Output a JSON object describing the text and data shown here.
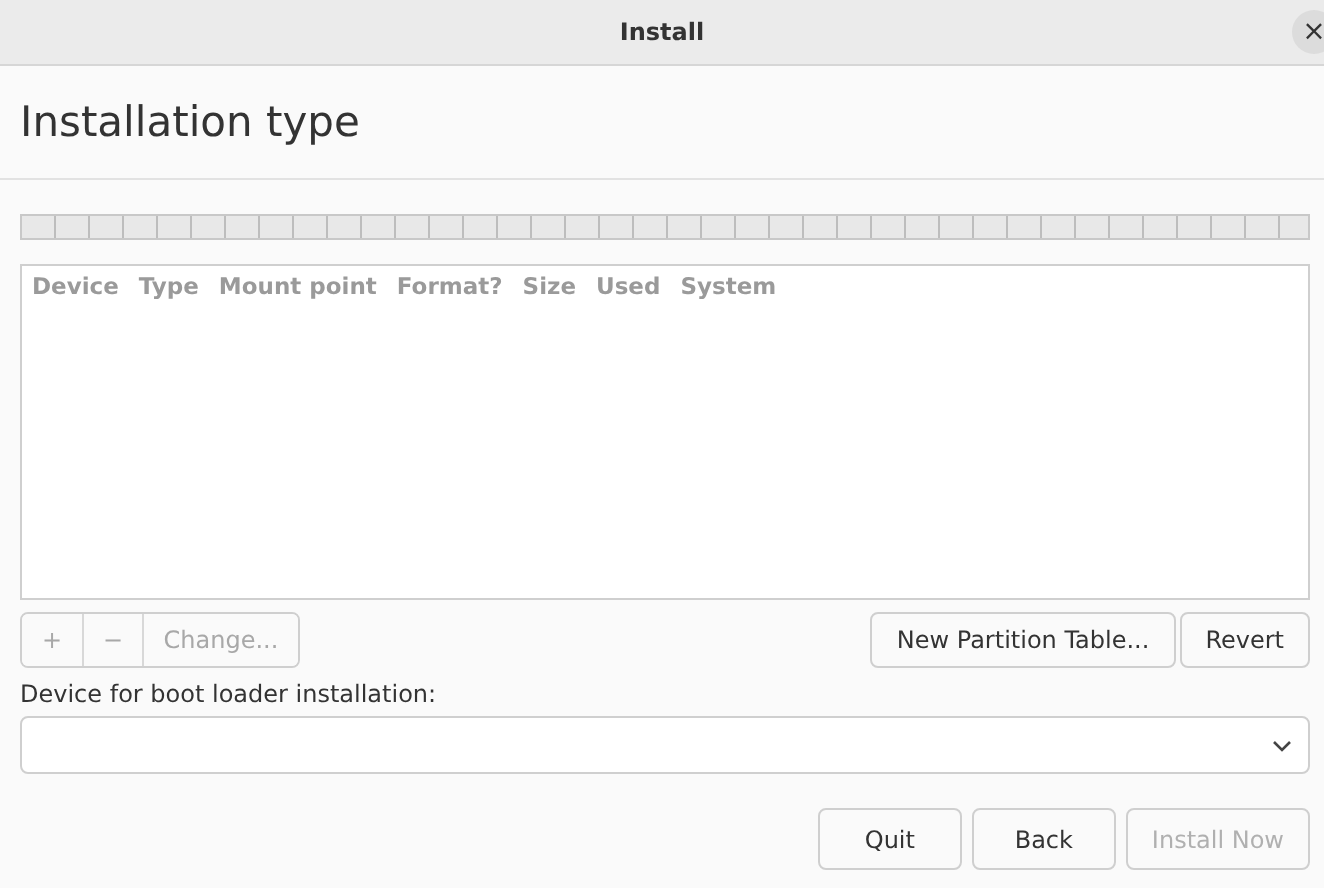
{
  "window": {
    "title": "Install",
    "close": "×"
  },
  "heading": "Installation type",
  "table": {
    "columns": [
      "Device",
      "Type",
      "Mount point",
      "Format?",
      "Size",
      "Used",
      "System"
    ]
  },
  "partition_tools": [
    {
      "label": "+",
      "disabled": true
    },
    {
      "label": "−",
      "disabled": true
    },
    {
      "label": "Change...",
      "disabled": true
    }
  ],
  "partition_actions": [
    {
      "label": "New Partition Table...",
      "disabled": false
    },
    {
      "label": "Revert",
      "disabled": false
    }
  ],
  "boot_loader": {
    "label": "Device for boot loader installation:"
  },
  "buttons": [
    {
      "label": "Quit",
      "disabled": false
    },
    {
      "label": "Back",
      "disabled": false
    },
    {
      "label": "Install Now",
      "disabled": true
    }
  ]
}
